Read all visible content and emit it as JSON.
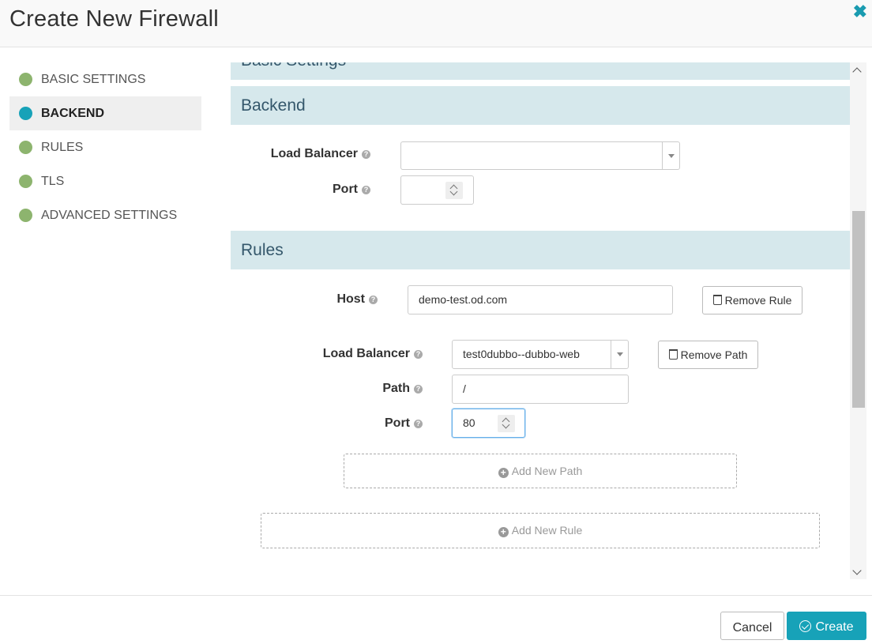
{
  "dialog": {
    "title": "Create New Firewall",
    "close_glyph": "✖"
  },
  "nav": {
    "items": [
      {
        "label": "BASIC SETTINGS",
        "state": "done"
      },
      {
        "label": "BACKEND",
        "state": "active"
      },
      {
        "label": "RULES",
        "state": "done"
      },
      {
        "label": "TLS",
        "state": "done"
      },
      {
        "label": "ADVANCED SETTINGS",
        "state": "done"
      }
    ]
  },
  "sections": {
    "basic_title": "Basic Settings",
    "backend_title": "Backend",
    "rules_title": "Rules"
  },
  "backend": {
    "load_balancer_label": "Load Balancer",
    "load_balancer_value": "",
    "port_label": "Port",
    "port_value": ""
  },
  "rule": {
    "host_label": "Host",
    "host_value": "demo-test.od.com",
    "remove_rule_label": "Remove Rule",
    "path": {
      "load_balancer_label": "Load Balancer",
      "load_balancer_value": "test0dubbo--dubbo-web",
      "remove_path_label": "Remove Path",
      "path_label": "Path",
      "path_value": "/",
      "port_label": "Port",
      "port_value": "80"
    },
    "add_path_label": "Add New Path"
  },
  "add_rule_label": "Add New Rule",
  "footer": {
    "cancel_label": "Cancel",
    "create_label": "Create"
  },
  "colors": {
    "accent": "#17a2b8",
    "done_dot": "#8db46e",
    "section_bg": "#d6e8ec"
  },
  "help_glyph": "?"
}
